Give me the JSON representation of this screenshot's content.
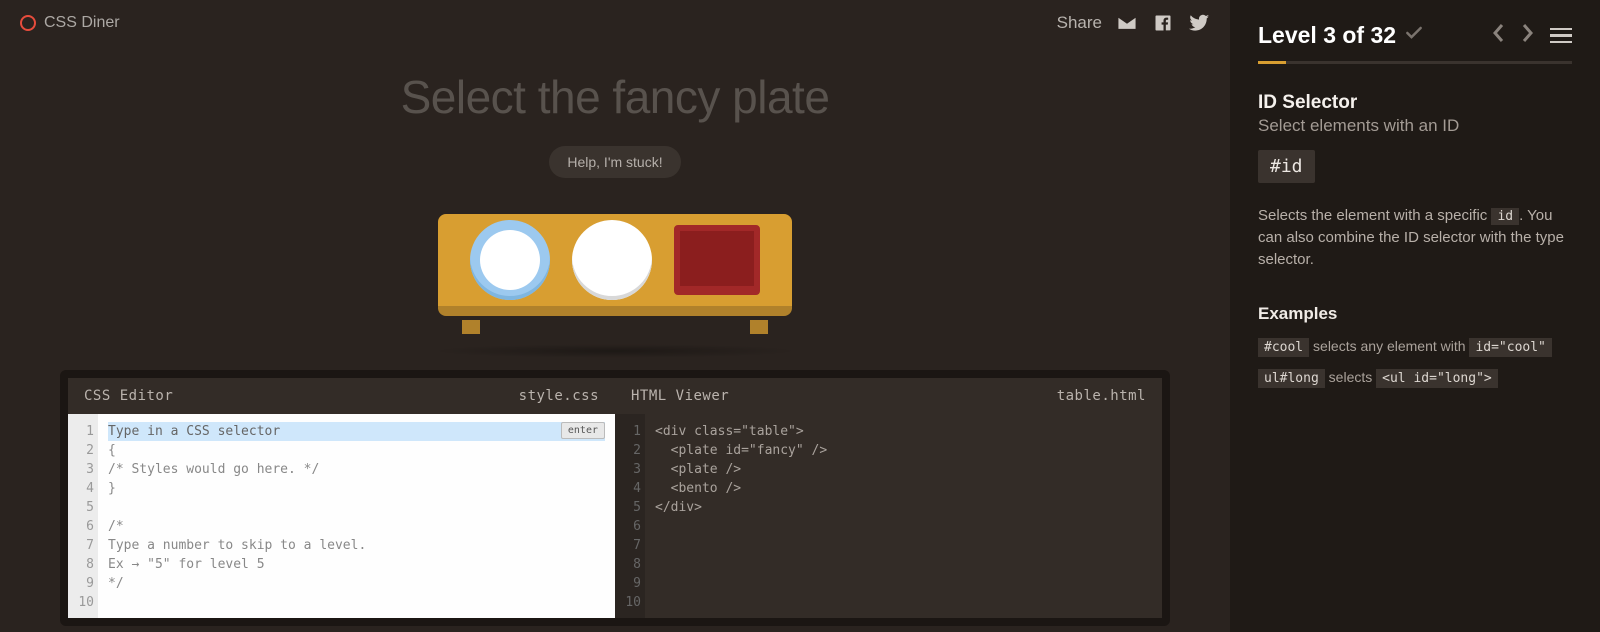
{
  "header": {
    "brand": "CSS Diner",
    "share_label": "Share"
  },
  "order": "Select the fancy plate",
  "help_label": "Help, I'm stuck!",
  "table_items": [
    "plate-fancy",
    "plate",
    "bento"
  ],
  "editor": {
    "left_title": "CSS Editor",
    "left_file": "style.css",
    "right_title": "HTML Viewer",
    "right_file": "table.html",
    "enter_label": "enter",
    "input_placeholder": "Type in a CSS selector",
    "left_lines": [
      "",
      "{",
      "/* Styles would go here. */",
      "}",
      "",
      "/*",
      "Type a number to skip to a level.",
      "Ex → \"5\" for level 5",
      "*/",
      ""
    ],
    "right_lines": [
      "<div class=\"table\">",
      "  <plate id=\"fancy\" />",
      "  <plate />",
      "  <bento />",
      "</div>",
      "",
      "",
      "",
      "",
      ""
    ]
  },
  "sidebar": {
    "level_label": "Level 3 of 32",
    "selector_name": "ID Selector",
    "selector_sub": "Select elements with an ID",
    "syntax": "#id",
    "desc_pre": "Selects the element with a specific ",
    "desc_code": "id",
    "desc_post": ". You can also combine the ID selector with the type selector.",
    "examples_heading": "Examples",
    "examples": [
      {
        "code_a": "#cool",
        "text": " selects any element with ",
        "code_b": "id=\"cool\""
      },
      {
        "code_a": "ul#long",
        "text": " selects ",
        "code_b": "<ul id=\"long\">"
      }
    ]
  }
}
